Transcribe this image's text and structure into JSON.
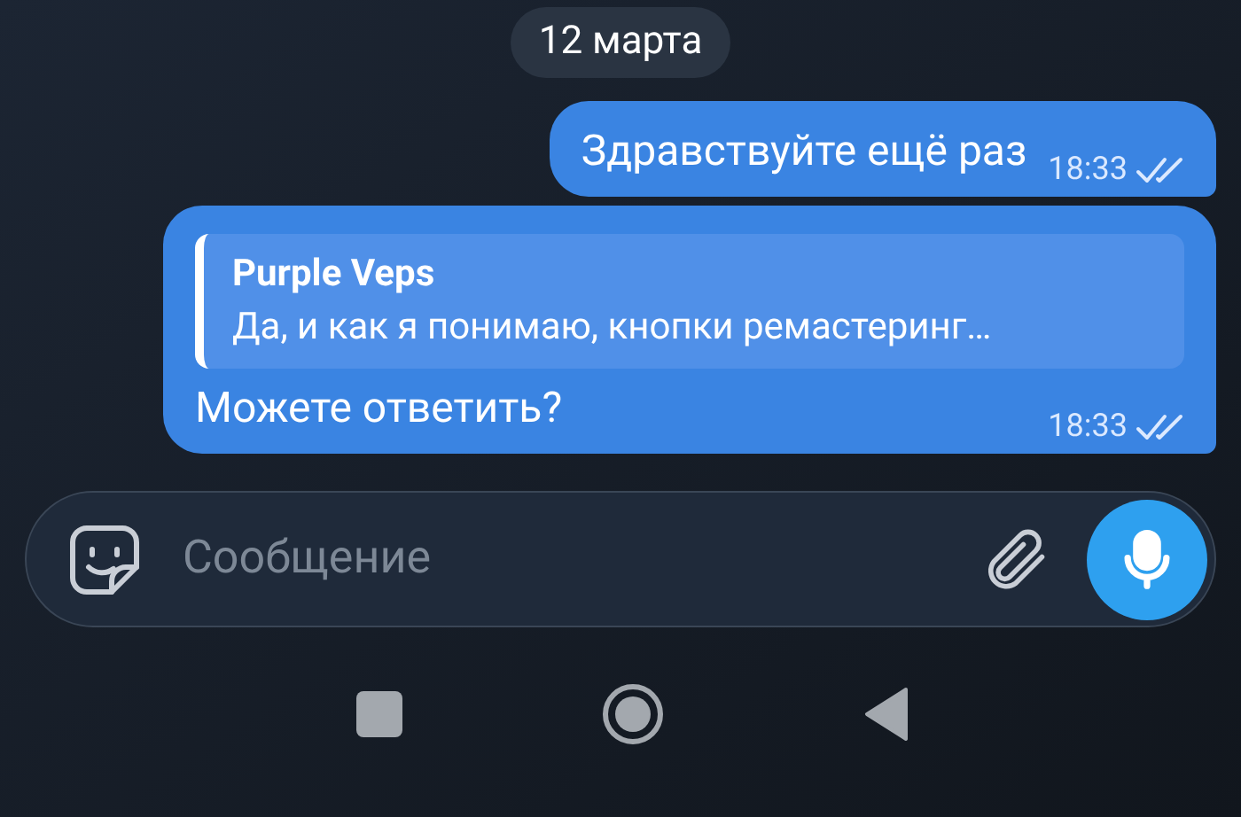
{
  "date_chip": "12 марта",
  "messages": [
    {
      "kind": "plain",
      "text": "Здравствуйте ещё раз",
      "time": "18:33",
      "read": true
    },
    {
      "kind": "reply",
      "quote": {
        "author": "Purple Veps",
        "text": "Да, и как я понимаю, кнопки ремастеринг…"
      },
      "text": "Можете ответить?",
      "time": "18:33",
      "read": true
    }
  ],
  "composer": {
    "placeholder": "Сообщение"
  }
}
